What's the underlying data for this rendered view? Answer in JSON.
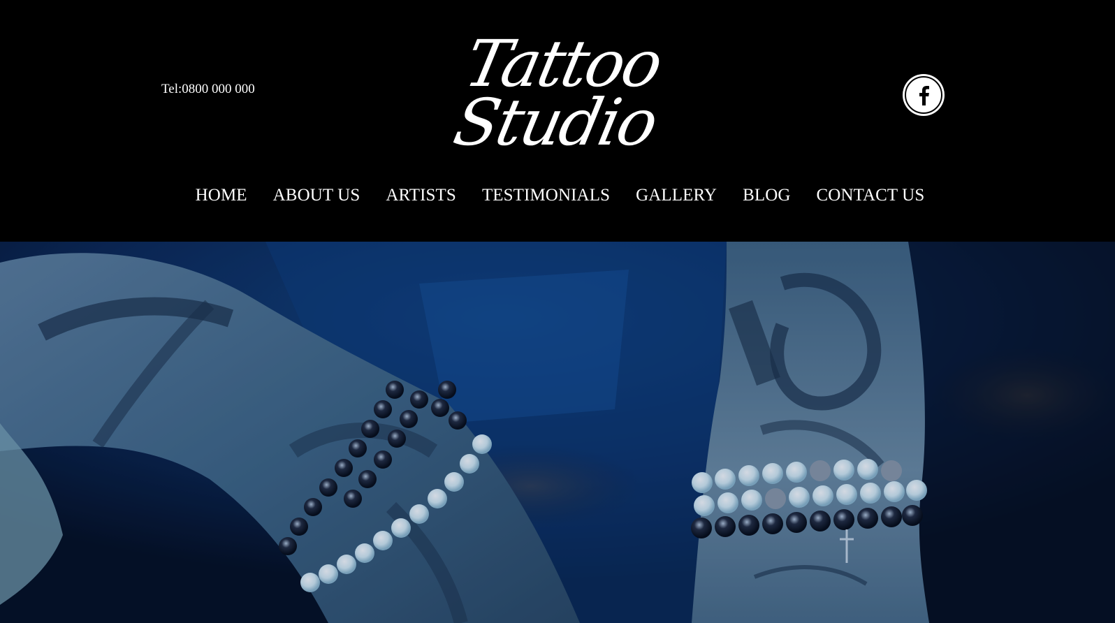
{
  "header": {
    "phone": "Tel:0800 000 000",
    "logo": {
      "line1": "Tattoo",
      "line2": "Studio"
    },
    "social": {
      "icon": "facebook-icon"
    }
  },
  "nav": {
    "items": [
      {
        "label": "HOME"
      },
      {
        "label": "ABOUT US"
      },
      {
        "label": "ARTISTS"
      },
      {
        "label": "TESTIMONIALS"
      },
      {
        "label": "GALLERY"
      },
      {
        "label": "BLOG"
      },
      {
        "label": "CONTACT US"
      }
    ]
  },
  "colors": {
    "background": "#000000",
    "text": "#ffffff",
    "hero_tint": "#0b2a5c"
  }
}
